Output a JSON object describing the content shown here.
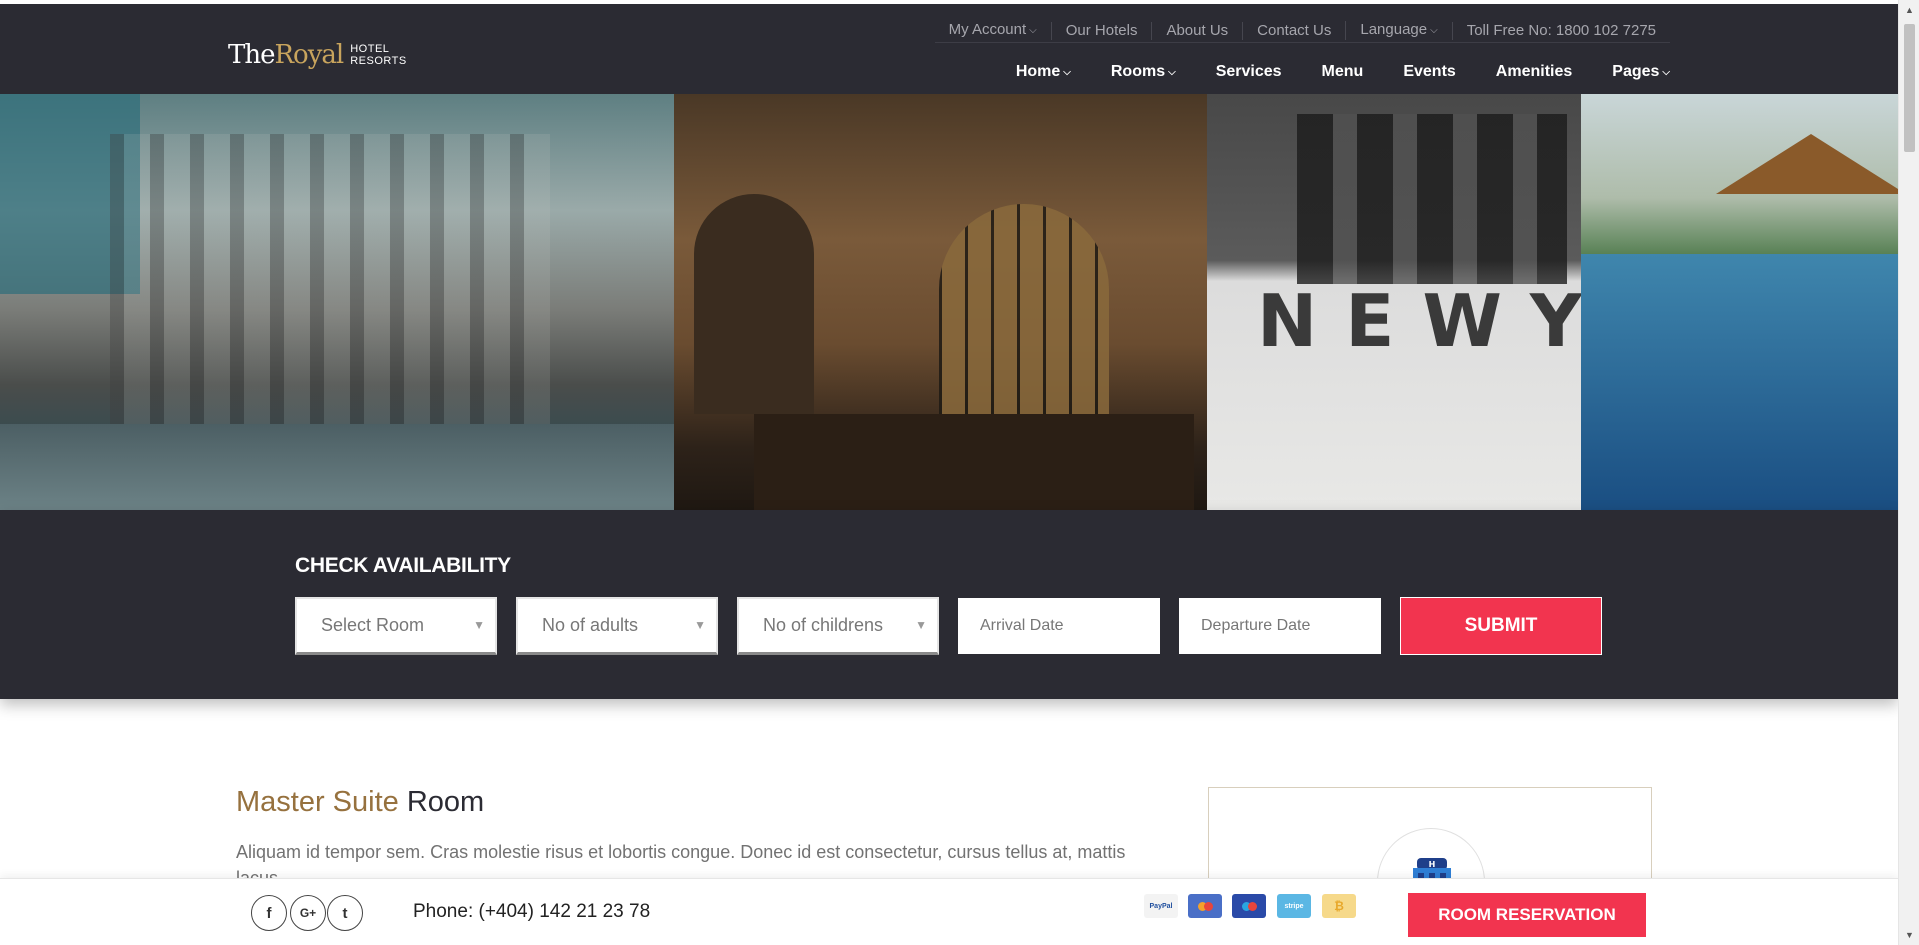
{
  "brand": {
    "the": "The",
    "royal": "Royal",
    "sub1": "HOTEL",
    "sub2": "RESORTS"
  },
  "top_links": [
    "My Account",
    "Our Hotels",
    "About Us",
    "Contact Us",
    "Language",
    "Toll Free No: 1800 102 7275"
  ],
  "main_nav": [
    "Home",
    "Rooms",
    "Services",
    "Menu",
    "Events",
    "Amenities",
    "Pages"
  ],
  "availability": {
    "title": "CHECK AVAILABILITY",
    "room_placeholder": "Select Room",
    "adults_placeholder": "No of adults",
    "children_placeholder": "No of childrens",
    "arrival_placeholder": "Arrival Date",
    "departure_placeholder": "Departure Date",
    "submit_label": "SUBMIT"
  },
  "content": {
    "title_gold": "Master Suite",
    "title_dark": " Room",
    "text": "Aliquam id tempor sem. Cras molestie risus et lobortis congue. Donec id est consectetur, cursus tellus at, mattis lacus."
  },
  "footer": {
    "social": [
      "facebook-icon",
      "google-plus-icon",
      "twitter-icon"
    ],
    "social_glyphs": [
      "f",
      "G+",
      "t"
    ],
    "phone": "Phone: (+404) 142 21 23 78",
    "payments": [
      "PayPal",
      "mastercard",
      "maestro",
      "stripe",
      "bitcoin"
    ],
    "reserve_label": "ROOM RESERVATION"
  },
  "colors": {
    "accent": "#f2344f",
    "dark": "#2b2b33",
    "gold": "#96713e"
  }
}
